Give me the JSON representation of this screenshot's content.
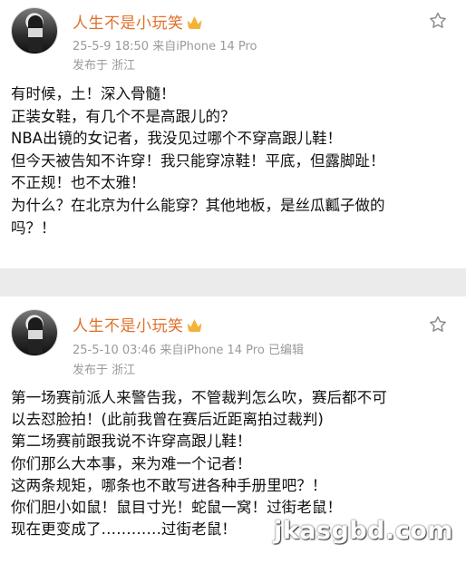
{
  "posts": [
    {
      "username": "人生不是小玩笑",
      "date": "25-5-9 18:50",
      "device": "来自iPhone 14 Pro",
      "edited": "",
      "location": "发布于 浙江",
      "lines": [
        "有时候，土！深入骨髓！",
        "正装女鞋，有几个不是高跟儿的？",
        "NBA出镜的女记者，我没见过哪个不穿高跟儿鞋！",
        "但今天被告知不许穿！我只能穿凉鞋！平底，但露脚趾！",
        "不正规！也不太雅！",
        "为什么？在北京为什么能穿？其他地板，是丝瓜瓤子做的",
        "吗？！"
      ]
    },
    {
      "username": "人生不是小玩笑",
      "date": "25-5-10 03:46",
      "device": "来自iPhone 14 Pro",
      "edited": "已编辑",
      "location": "发布于 浙江",
      "lines": [
        "第一场赛前派人来警告我，不管裁判怎么吹，赛后都不可",
        "以去怼脸拍！(此前我曾在赛后近距离拍过裁判)",
        "第二场赛前跟我说不许穿高跟儿鞋！",
        "你们那么大本事，来为难一个记者！",
        "这两条规矩，哪条也不敢写进各种手册里吧？！",
        "你们胆小如鼠！鼠目寸光！蛇鼠一窝！过街老鼠！",
        "现在更变成了…………过街老鼠！"
      ]
    }
  ],
  "watermark": "jkasgbd.com",
  "icons": {
    "star": "star-outline-icon",
    "verified": "crown-badge-icon"
  },
  "colors": {
    "username": "#e0702a",
    "meta": "#9a9a9a",
    "background": "#ebebeb"
  }
}
